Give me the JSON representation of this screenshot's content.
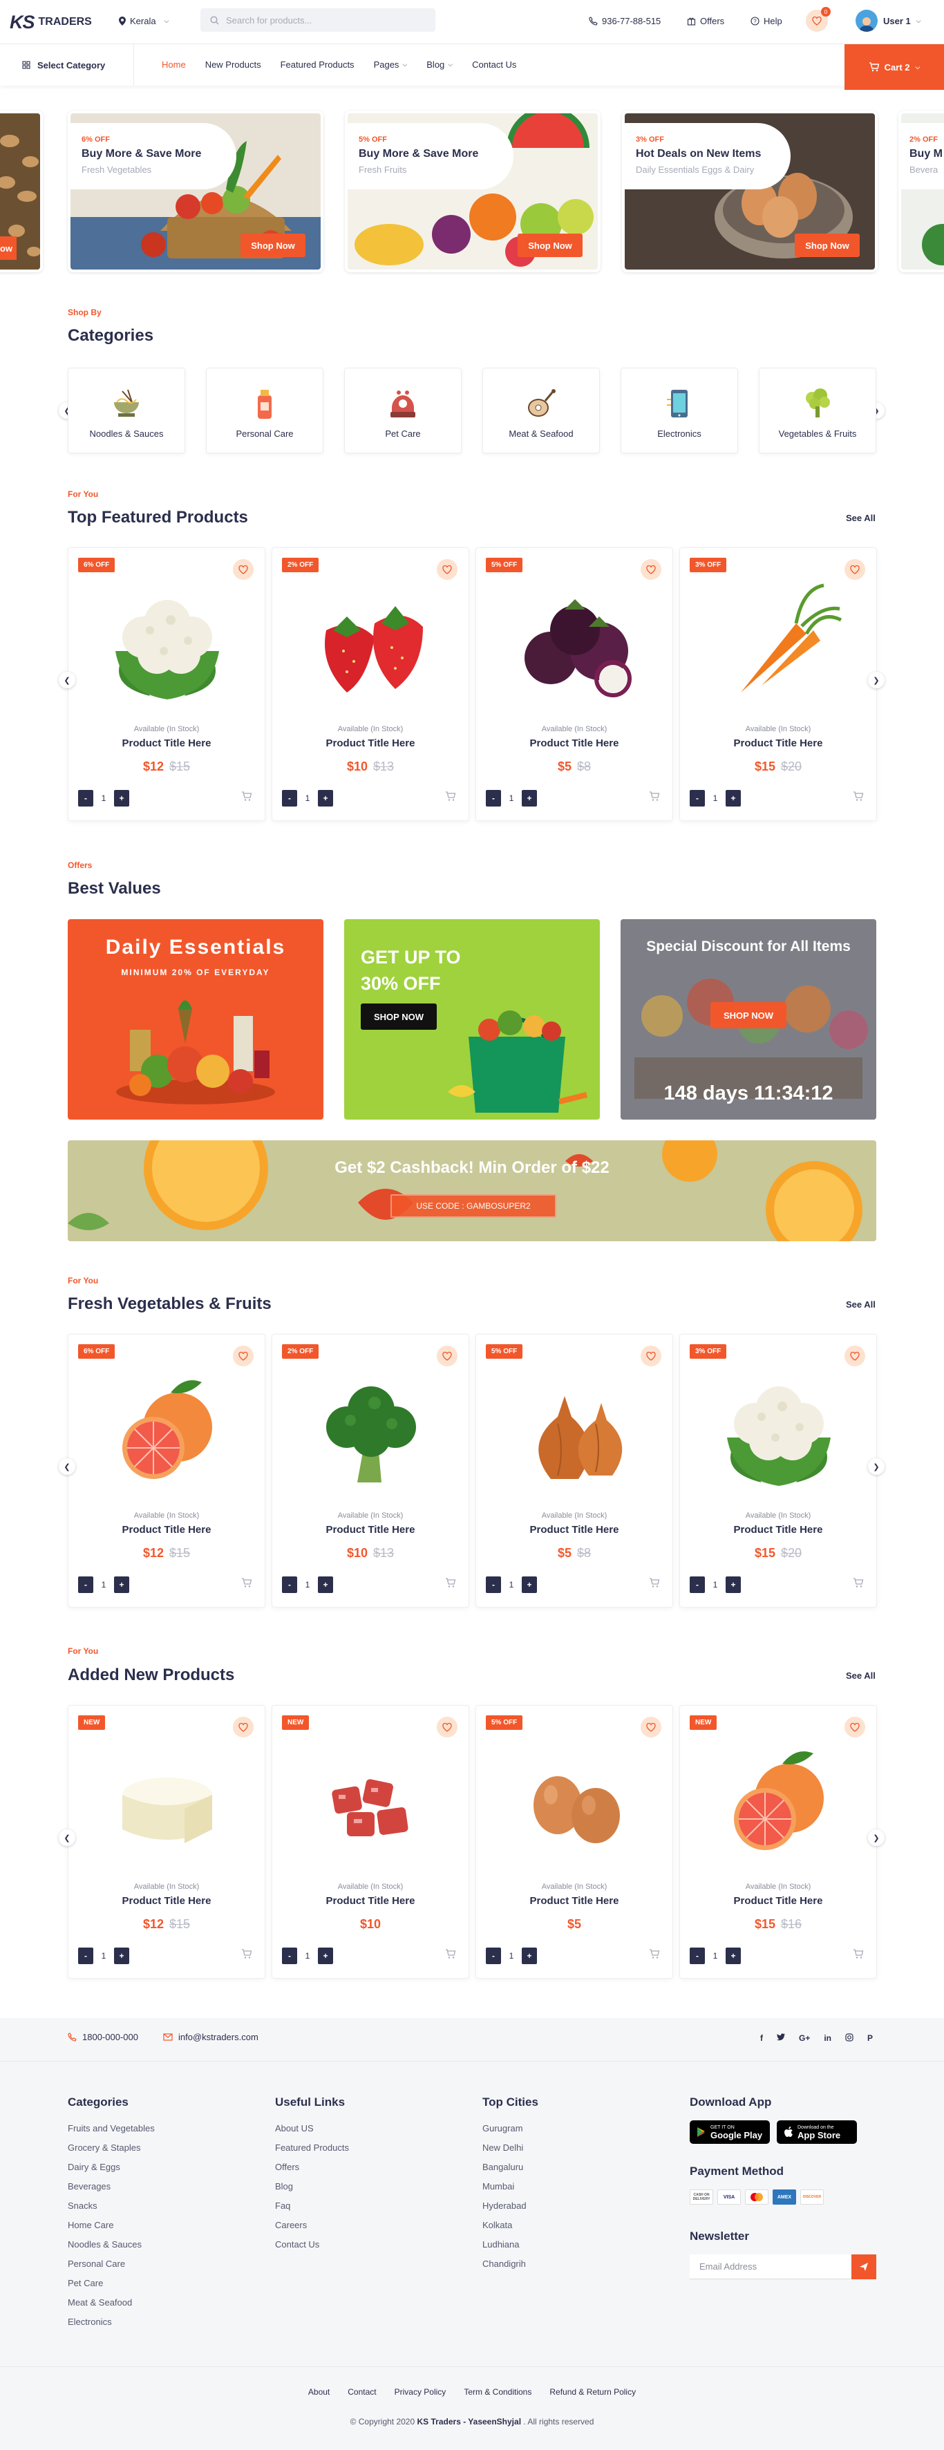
{
  "header": {
    "logo_ks": "KS",
    "logo_traders": "TRADERS",
    "location": "Kerala",
    "search_placeholder": "Search for products...",
    "phone": "936-77-88-515",
    "offers": "Offers",
    "help": "Help",
    "wishlist_count": "0",
    "user": "User 1"
  },
  "nav": {
    "select_category": "Select Category",
    "items": [
      "Home",
      "New Products",
      "Featured Products",
      "Pages",
      "Blog",
      "Contact Us"
    ],
    "cart": "Cart 2"
  },
  "banners": [
    {
      "off": "6% OFF",
      "title": "Buy More & Save More",
      "sub": "Fresh Vegetables",
      "cta": "Shop Now"
    },
    {
      "off": "5% OFF",
      "title": "Buy More & Save More",
      "sub": "Fresh Fruits",
      "cta": "Shop Now"
    },
    {
      "off": "3% OFF",
      "title": "Hot Deals on New Items",
      "sub": "Daily Essentials Eggs & Dairy",
      "cta": "Shop Now"
    },
    {
      "off": "2% OFF",
      "title": "Buy M",
      "sub": "Bevera"
    }
  ],
  "left_partial_cta": "ow",
  "categories_section": {
    "eyebrow": "Shop By",
    "title": "Categories",
    "items": [
      "Noodles & Sauces",
      "Personal Care",
      "Pet Care",
      "Meat & Seafood",
      "Electronics",
      "Vegetables & Fruits"
    ]
  },
  "featured": {
    "eyebrow": "For You",
    "title": "Top Featured Products",
    "see_all": "See All",
    "products": [
      {
        "badge": "6% OFF",
        "img": "cauliflower",
        "avail": "Available (In Stock)",
        "title": "Product Title Here",
        "price": "$12",
        "old": "$15",
        "qty": "1"
      },
      {
        "badge": "2% OFF",
        "img": "strawberry",
        "avail": "Available (In Stock)",
        "title": "Product Title Here",
        "price": "$10",
        "old": "$13",
        "qty": "1"
      },
      {
        "badge": "5% OFF",
        "img": "mangosteen",
        "avail": "Available (In Stock)",
        "title": "Product Title Here",
        "price": "$5",
        "old": "$8",
        "qty": "1"
      },
      {
        "badge": "3% OFF",
        "img": "carrot",
        "avail": "Available (In Stock)",
        "title": "Product Title Here",
        "price": "$15",
        "old": "$20",
        "qty": "1"
      }
    ]
  },
  "offers": {
    "eyebrow": "Offers",
    "title": "Best Values",
    "promo1_title": "Daily Essentials",
    "promo1_sub": "MINIMUM 20% OF EVERYDAY",
    "promo2_title1": "GET UP TO",
    "promo2_title2": "30% OFF",
    "promo2_cta": "SHOP NOW",
    "promo3_title": "Special Discount for All Items",
    "promo3_cta": "SHOP NOW",
    "promo3_timer": "148 days 11:34:12",
    "cashback_title": "Get $2 Cashback! Min Order of $22",
    "cashback_code": "USE CODE : GAMBOSUPER2"
  },
  "fresh": {
    "eyebrow": "For You",
    "title": "Fresh Vegetables & Fruits",
    "see_all": "See All",
    "products": [
      {
        "badge": "6% OFF",
        "img": "grapefruit",
        "avail": "Available (In Stock)",
        "title": "Product Title Here",
        "price": "$12",
        "old": "$15",
        "qty": "1"
      },
      {
        "badge": "2% OFF",
        "img": "broccoli",
        "avail": "Available (In Stock)",
        "title": "Product Title Here",
        "price": "$10",
        "old": "$13",
        "qty": "1"
      },
      {
        "badge": "5% OFF",
        "img": "onion",
        "avail": "Available (In Stock)",
        "title": "Product Title Here",
        "price": "$5",
        "old": "$8",
        "qty": "1"
      },
      {
        "badge": "3% OFF",
        "img": "cauliflower",
        "avail": "Available (In Stock)",
        "title": "Product Title Here",
        "price": "$15",
        "old": "$20",
        "qty": "1"
      }
    ]
  },
  "newprod": {
    "eyebrow": "For You",
    "title": "Added New Products",
    "see_all": "See All",
    "products": [
      {
        "badge": "NEW",
        "img": "cheese",
        "avail": "Available (In Stock)",
        "title": "Product Title Here",
        "price": "$12",
        "old": "$15",
        "qty": "1"
      },
      {
        "badge": "NEW",
        "img": "meat",
        "avail": "Available (In Stock)",
        "title": "Product Title Here",
        "price": "$10",
        "old": "",
        "qty": "1"
      },
      {
        "badge": "5% OFF",
        "img": "eggs",
        "avail": "Available (In Stock)",
        "title": "Product Title Here",
        "price": "$5",
        "old": "",
        "qty": "1"
      },
      {
        "badge": "NEW",
        "img": "grapefruit",
        "avail": "Available (In Stock)",
        "title": "Product Title Here",
        "price": "$15",
        "old": "$16",
        "qty": "1"
      }
    ]
  },
  "footer": {
    "phone": "1800-000-000",
    "email": "info@kstraders.com",
    "col1_title": "Categories",
    "col1": [
      "Fruits and Vegetables",
      "Grocery & Staples",
      "Dairy & Eggs",
      "Beverages",
      "Snacks",
      "Home Care",
      "Noodles & Sauces",
      "Personal Care",
      "Pet Care",
      "Meat & Seafood",
      "Electronics"
    ],
    "col2_title": "Useful Links",
    "col2": [
      "About US",
      "Featured Products",
      "Offers",
      "Blog",
      "Faq",
      "Careers",
      "Contact Us"
    ],
    "col3_title": "Top Cities",
    "col3": [
      "Gurugram",
      "New Delhi",
      "Bangaluru",
      "Mumbai",
      "Hyderabad",
      "Kolkata",
      "Ludhiana",
      "Chandigrih"
    ],
    "download_title": "Download App",
    "gp_small": "GET IT ON",
    "gp_big": "Google Play",
    "as_small": "Download on the",
    "as_big": "App Store",
    "payment_title": "Payment Method",
    "payments": [
      "CASH ON DELIVERY",
      "VISA",
      "MC",
      "AMEX",
      "DISCOVER"
    ],
    "newsletter_title": "Newsletter",
    "email_placeholder": "Email Address",
    "bottom_links": [
      "About",
      "Contact",
      "Privacy Policy",
      "Term & Conditions",
      "Refund & Return Policy"
    ],
    "copyright_pre": "© Copyright 2020 ",
    "copyright_brand": "KS Traders - YaseenShyjal",
    "copyright_post": " . All rights reserved"
  },
  "colors": {
    "accent": "#f2572b",
    "navy": "#2b2f4c",
    "peach": "#fde2cf"
  }
}
